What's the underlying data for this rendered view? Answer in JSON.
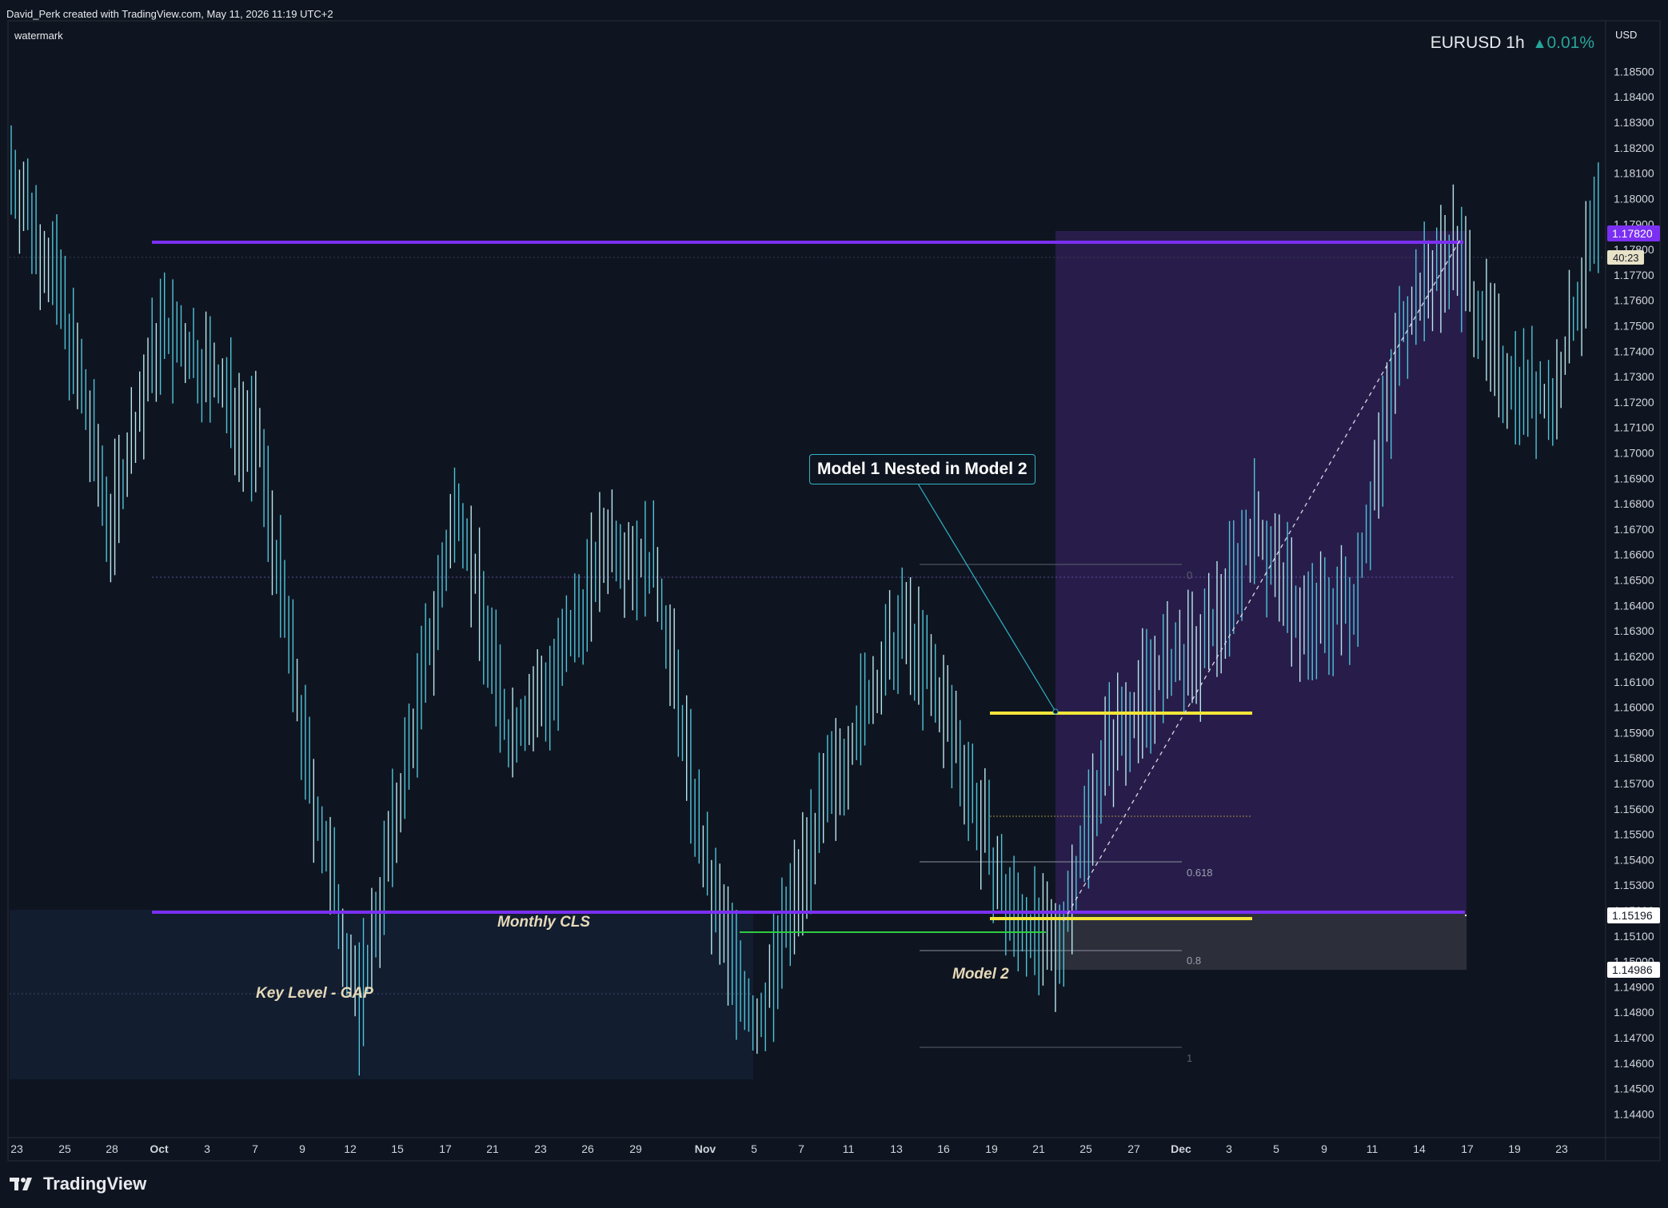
{
  "header": {
    "attribution": "David_Perk created with TradingView.com, May 11, 2026 11:19 UTC+2",
    "watermark_label": "watermark"
  },
  "symbol": {
    "name": "EURUSD 1h",
    "change": "0.01%",
    "change_color": "#26a69a"
  },
  "footer": {
    "brand": "TradingView",
    "logo_icon": "tradingview-logo-icon"
  },
  "price_axis": {
    "currency": "USD",
    "ticks": [
      "1.18500",
      "1.18400",
      "1.18300",
      "1.18200",
      "1.18100",
      "1.18000",
      "1.17900",
      "1.17800",
      "1.17700",
      "1.17600",
      "1.17500",
      "1.17400",
      "1.17300",
      "1.17200",
      "1.17100",
      "1.17000",
      "1.16900",
      "1.16800",
      "1.16700",
      "1.16600",
      "1.16500",
      "1.16400",
      "1.16300",
      "1.16200",
      "1.16100",
      "1.16000",
      "1.15900",
      "1.15800",
      "1.15700",
      "1.15600",
      "1.15500",
      "1.15400",
      "1.15300",
      "1.15200",
      "1.15100",
      "1.15000",
      "1.14900",
      "1.14800",
      "1.14700",
      "1.14600",
      "1.14500",
      "1.14400"
    ],
    "current_price_label": "1.17820",
    "current_price_color": "#7b2ff2",
    "countdown_label": "40:23",
    "marker_upper": "1.15196",
    "marker_lower": "1.14986"
  },
  "time_axis": {
    "labels": [
      {
        "text": "23",
        "bold": false
      },
      {
        "text": "25",
        "bold": false
      },
      {
        "text": "28",
        "bold": false
      },
      {
        "text": "Oct",
        "bold": true
      },
      {
        "text": "3",
        "bold": false
      },
      {
        "text": "7",
        "bold": false
      },
      {
        "text": "9",
        "bold": false
      },
      {
        "text": "12",
        "bold": false
      },
      {
        "text": "15",
        "bold": false
      },
      {
        "text": "17",
        "bold": false
      },
      {
        "text": "21",
        "bold": false
      },
      {
        "text": "23",
        "bold": false
      },
      {
        "text": "26",
        "bold": false
      },
      {
        "text": "29",
        "bold": false
      },
      {
        "text": "Nov",
        "bold": true
      },
      {
        "text": "5",
        "bold": false
      },
      {
        "text": "7",
        "bold": false
      },
      {
        "text": "11",
        "bold": false
      },
      {
        "text": "13",
        "bold": false
      },
      {
        "text": "16",
        "bold": false
      },
      {
        "text": "19",
        "bold": false
      },
      {
        "text": "21",
        "bold": false
      },
      {
        "text": "25",
        "bold": false
      },
      {
        "text": "27",
        "bold": false
      },
      {
        "text": "Dec",
        "bold": true
      },
      {
        "text": "3",
        "bold": false
      },
      {
        "text": "5",
        "bold": false
      },
      {
        "text": "9",
        "bold": false
      },
      {
        "text": "11",
        "bold": false
      },
      {
        "text": "14",
        "bold": false
      },
      {
        "text": "17",
        "bold": false
      },
      {
        "text": "19",
        "bold": false
      },
      {
        "text": "23",
        "bold": false
      }
    ]
  },
  "annotations": {
    "callout": "Model 1 Nested in Model 2",
    "monthly_cls": "Monthly CLS",
    "key_level": "Key Level - GAP",
    "model2": "Model 2",
    "fib_0": "0",
    "fib_0618": "0.618",
    "fib_08": "0.8",
    "fib_1": "1"
  },
  "colors": {
    "background": "#0f1520",
    "candle": "#4fc3d9",
    "candle_light": "#b8e6ee",
    "monthly_cls_line": "#7b2ff2",
    "yellow_level": "#f3e53a",
    "green_level": "#2ecc40",
    "long_box": "#2a1e4d",
    "gap_zone": "#121d30",
    "callout_border": "#2fb4c8"
  },
  "chart_data": {
    "type": "line",
    "title": "EURUSD 1h",
    "ylim": [
      1.1435,
      1.1865
    ],
    "x": [
      "Sep 23",
      "Sep 25",
      "Sep 28",
      "Oct 1",
      "Oct 3",
      "Oct 7",
      "Oct 9",
      "Oct 12",
      "Oct 15",
      "Oct 17",
      "Oct 21",
      "Oct 23",
      "Oct 26",
      "Oct 29",
      "Nov 1",
      "Nov 5",
      "Nov 7",
      "Nov 11",
      "Nov 13",
      "Nov 16",
      "Nov 19",
      "Nov 21",
      "Nov 25",
      "Nov 27",
      "Dec 1",
      "Dec 3",
      "Dec 5",
      "Dec 9",
      "Dec 11",
      "Dec 14",
      "Dec 17",
      "Dec 19",
      "Dec 23"
    ],
    "series": [
      {
        "values": [
          1.1812,
          1.1762,
          1.1672,
          1.1748,
          1.1732,
          1.1702,
          1.1572,
          1.1482,
          1.1582,
          1.1682,
          1.1588,
          1.1612,
          1.1668,
          1.1652,
          1.1532,
          1.1472,
          1.1542,
          1.1592,
          1.1632,
          1.1588,
          1.1522,
          1.1502,
          1.1582,
          1.1612,
          1.1622,
          1.1672,
          1.1632,
          1.1642,
          1.1752,
          1.1782,
          1.1732,
          1.1718,
          1.1798
        ]
      }
    ]
  }
}
